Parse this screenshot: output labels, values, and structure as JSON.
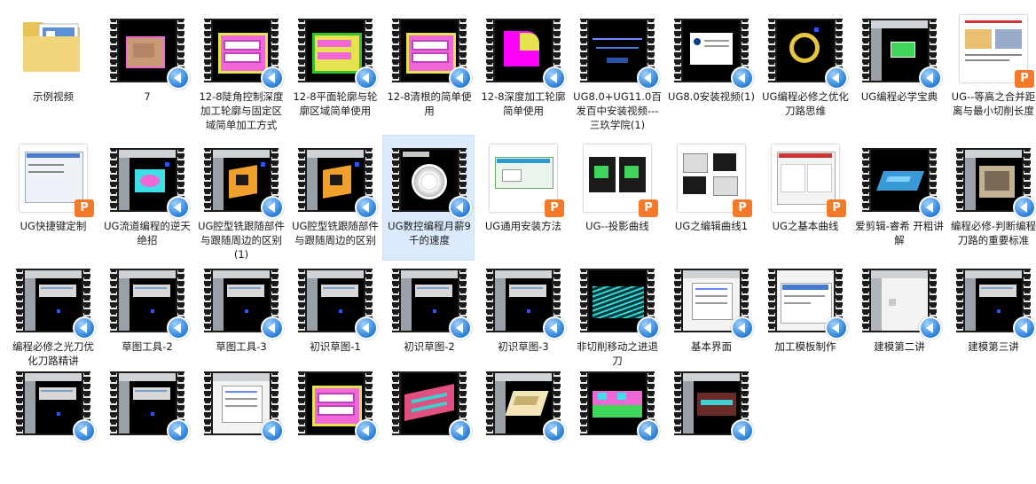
{
  "colors": {
    "selection_bg": "#dcebfc",
    "film": "#1b1b1b",
    "play_badge": "#2b7fd6",
    "doc_badge": "#f47a2a"
  },
  "items": [
    {
      "label": "示例视频",
      "type": "folder"
    },
    {
      "label": "7",
      "type": "video",
      "art": "pink-block"
    },
    {
      "label": "12-8陡角控制深度加工轮廓与固定区域简单加工方式",
      "type": "video",
      "art": "pink-toolpath"
    },
    {
      "label": "12-8平面轮廓与轮廓区域简单使用",
      "type": "video",
      "art": "green-toolpath"
    },
    {
      "label": "12-8清根的简单使用",
      "type": "video",
      "art": "pink-toolpath"
    },
    {
      "label": "12-8深度加工轮廓简单使用",
      "type": "video",
      "art": "magenta-square"
    },
    {
      "label": "UG8.0+UG11.0百发百中安装视频---三玖学院(1)",
      "type": "video",
      "art": "dark-title"
    },
    {
      "label": "UG8.0安装视频(1)",
      "type": "video",
      "art": "dark-dialog"
    },
    {
      "label": "UG编程必修之优化刀路思维",
      "type": "video",
      "art": "yellow-ring"
    },
    {
      "label": "UG编程必学宝典",
      "type": "video",
      "art": "ui-green"
    },
    {
      "label": "UG--等高之合并距离与最小切削长度",
      "type": "doc",
      "art": "doc-diagram"
    },
    {
      "label": "UG快捷键定制",
      "type": "doc",
      "art": "doc-dialog"
    },
    {
      "label": "UG流道编程的逆天绝招",
      "type": "video",
      "art": "cyan-part"
    },
    {
      "label": "UG腔型铣跟随部件与跟随周边的区别 (1)",
      "type": "video",
      "art": "orange-block"
    },
    {
      "label": "UG腔型铣跟随部件与跟随周边的区别",
      "type": "video",
      "art": "orange-block"
    },
    {
      "label": "UG数控编程月薪9千的速度",
      "type": "video",
      "art": "white-disc",
      "selected": true
    },
    {
      "label": "UG通用安装方法",
      "type": "doc",
      "art": "doc-install"
    },
    {
      "label": "UG--投影曲线",
      "type": "doc",
      "art": "doc-green"
    },
    {
      "label": "UG之编辑曲线1",
      "type": "doc",
      "art": "doc-blocks"
    },
    {
      "label": "UG之基本曲线",
      "type": "doc",
      "art": "doc-form"
    },
    {
      "label": "爱剪辑-睿希 开粗讲解",
      "type": "video",
      "art": "blue-part"
    },
    {
      "label": "编程必修-判断编程刀路的重要标准",
      "type": "video",
      "art": "ui-mold"
    },
    {
      "label": "编程必修之光刀优化刀路精讲",
      "type": "video",
      "art": "ui-dark"
    },
    {
      "label": "草图工具-2",
      "type": "video",
      "art": "ui-dark"
    },
    {
      "label": "草图工具-3",
      "type": "video",
      "art": "ui-dark"
    },
    {
      "label": "初识草图-1",
      "type": "video",
      "art": "ui-dark"
    },
    {
      "label": "初识草图-2",
      "type": "video",
      "art": "ui-dark"
    },
    {
      "label": "初识草图-3",
      "type": "video",
      "art": "ui-dark"
    },
    {
      "label": "非切削移动之进退刀",
      "type": "video",
      "art": "cyan-lines"
    },
    {
      "label": "基本界面",
      "type": "video",
      "art": "ui-light"
    },
    {
      "label": "加工模板制作",
      "type": "video",
      "art": "white-dialog"
    },
    {
      "label": "建模第二讲",
      "type": "video",
      "art": "ui-grey"
    },
    {
      "label": "建模第三讲",
      "type": "video",
      "art": "ui-dark"
    },
    {
      "label": "",
      "type": "video",
      "art": "ui-dark"
    },
    {
      "label": "",
      "type": "video",
      "art": "ui-dark"
    },
    {
      "label": "",
      "type": "video",
      "art": "ui-light"
    },
    {
      "label": "",
      "type": "video",
      "art": "pink-toolpath"
    },
    {
      "label": "",
      "type": "video",
      "art": "pink-slots"
    },
    {
      "label": "",
      "type": "video",
      "art": "cream-part"
    },
    {
      "label": "",
      "type": "video",
      "art": "pink-green"
    },
    {
      "label": "",
      "type": "video",
      "art": "dark-part"
    }
  ]
}
